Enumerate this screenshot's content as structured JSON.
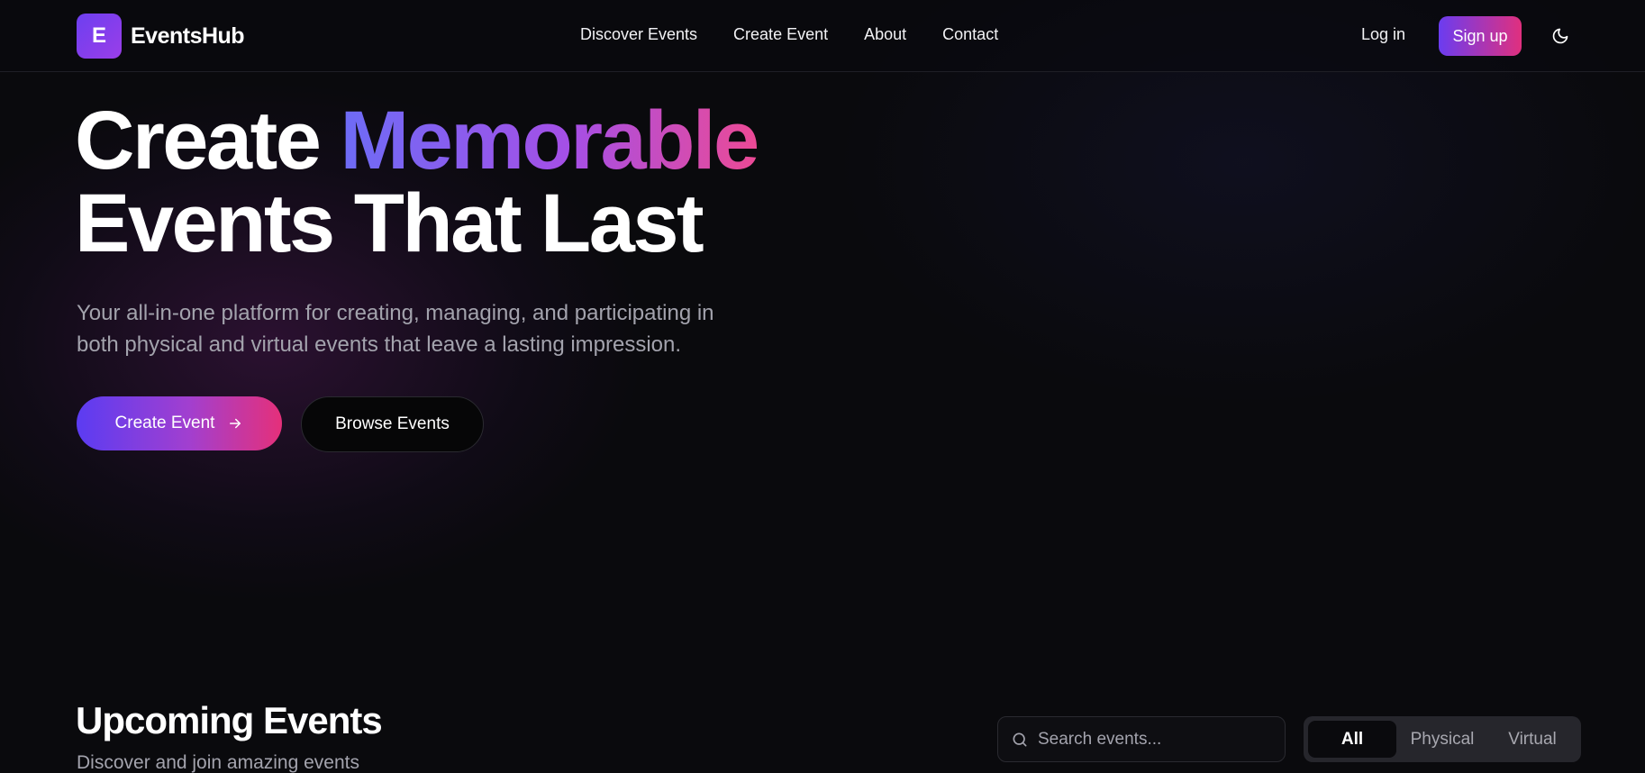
{
  "brand": {
    "logo_letter": "E",
    "name": "EventsHub",
    "accent_start": "#6d3ff0",
    "accent_end": "#e0307e"
  },
  "nav": {
    "links": [
      "Discover Events",
      "Create Event",
      "About",
      "Contact"
    ],
    "login_label": "Log in",
    "signup_label": "Sign up",
    "theme_icon": "moon-icon"
  },
  "hero": {
    "title_before": "Create ",
    "title_highlight": "Memorable",
    "title_line2": "Events That Last",
    "subtitle_line1": "Your all-in-one platform for creating, managing, and participating in",
    "subtitle_line2": "both physical and virtual events that leave a lasting impression.",
    "primary_button": "Create Event",
    "primary_button_icon": "arrow-right-icon",
    "secondary_button": "Browse Events"
  },
  "upcoming": {
    "title": "Upcoming Events",
    "subtitle": "Discover and join amazing events",
    "search_placeholder": "Search events...",
    "filters": [
      "All",
      "Physical",
      "Virtual"
    ],
    "active_filter": "All"
  }
}
